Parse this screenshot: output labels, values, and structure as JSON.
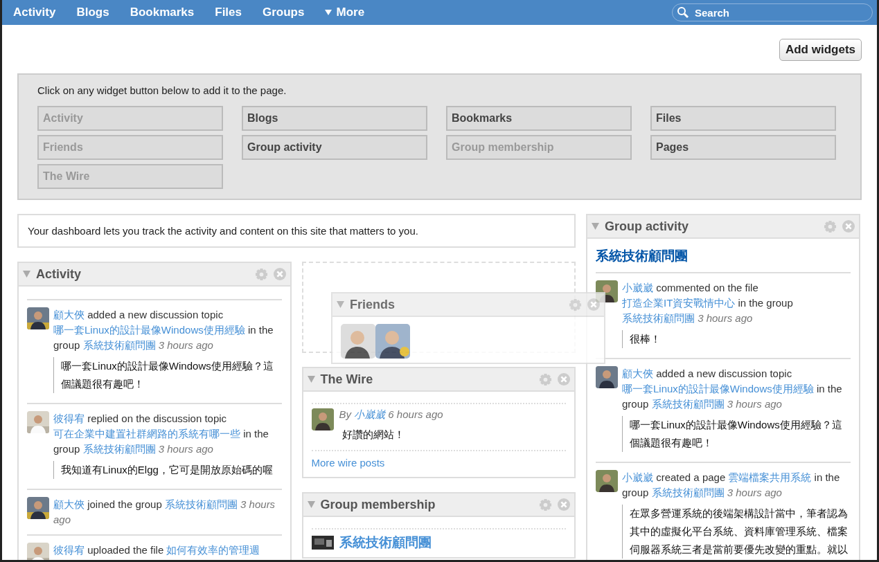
{
  "nav": {
    "items": [
      {
        "label": "Activity",
        "kind": "link"
      },
      {
        "label": "Blogs",
        "kind": "link"
      },
      {
        "label": "Bookmarks",
        "kind": "link"
      },
      {
        "label": "Files",
        "kind": "link"
      },
      {
        "label": "Groups",
        "kind": "link"
      },
      {
        "label": "More",
        "kind": "menu"
      }
    ],
    "search": {
      "placeholder": "Search"
    }
  },
  "add_widgets_button": "Add widgets",
  "widget_panel": {
    "hint": "Click on any widget button below to add it to the page.",
    "widgets": [
      {
        "label": "Activity",
        "disabled": true
      },
      {
        "label": "Blogs",
        "disabled": false
      },
      {
        "label": "Bookmarks",
        "disabled": false
      },
      {
        "label": "Files",
        "disabled": false
      },
      {
        "label": "Friends",
        "disabled": true
      },
      {
        "label": "Group activity",
        "disabled": false
      },
      {
        "label": "Group membership",
        "disabled": true
      },
      {
        "label": "Pages",
        "disabled": false
      },
      {
        "label": "The Wire",
        "disabled": true
      }
    ]
  },
  "intro": "Your dashboard lets you track the activity and content on this site that matters to you.",
  "activity_widget": {
    "title": "Activity",
    "items": [
      {
        "actor": "顧大俠",
        "action": "added a new discussion topic",
        "target": "哪一套Linux的設計最像Windows使用經驗",
        "connector": "in the group",
        "group": "系統技術顧問團",
        "time": "3 hours ago",
        "excerpt": "哪一套Linux的設計最像Windows使用經驗？這個議題很有趣吧！"
      },
      {
        "actor": "彼得宥",
        "action": "replied on the discussion topic",
        "target": "可在企業中建置社群網路的系統有哪一些",
        "connector": "in the group",
        "group": "系統技術顧問團",
        "time": "3 hours ago",
        "excerpt": "我知道有Linux的Elgg，它可是開放原始碼的喔"
      },
      {
        "actor": "顧大俠",
        "action": "joined the group",
        "group": "系統技術顧問團",
        "time": "3 hours ago"
      },
      {
        "actor": "彼得宥",
        "action": "uploaded the file",
        "target": "如何有效率的管理週"
      }
    ]
  },
  "friends_widget": {
    "title": "Friends"
  },
  "wire_widget": {
    "title": "The Wire",
    "posts": [
      {
        "by": "By",
        "author": "小崴崴",
        "time": "6 hours ago",
        "message": "好讚的網站！"
      }
    ],
    "more_link": "More wire posts"
  },
  "group_membership_widget": {
    "title": "Group membership",
    "groups": [
      {
        "name": "系統技術顧問團"
      }
    ]
  },
  "group_activity_widget": {
    "title": "Group activity",
    "group_name": "系統技術顧問團",
    "items": [
      {
        "actor": "小崴崴",
        "action": "commented on the file",
        "target": "打造企業IT資安戰情中心",
        "connector": "in the group",
        "group": "系統技術顧問團",
        "time": "3 hours ago",
        "excerpt": "很棒！"
      },
      {
        "actor": "顧大俠",
        "action": "added a new discussion topic",
        "target": "哪一套Linux的設計最像Windows使用經驗",
        "connector": "in the group",
        "group": "系統技術顧問團",
        "time": "3 hours ago",
        "excerpt": "哪一套Linux的設計最像Windows使用經驗？這個議題很有趣吧！"
      },
      {
        "actor": "小崴崴",
        "action": "created a page",
        "target": "雲端檔案共用系統",
        "connector": "in the group",
        "group": "系統技術顧問團",
        "time": "3 hours ago",
        "excerpt": "在眾多營運系統的後端架構設計當中，筆者認為其中的虛擬化平台系統、資料庫管理系統、檔案伺服器系統三者是當前要優先改變的重點。就以"
      }
    ]
  }
}
